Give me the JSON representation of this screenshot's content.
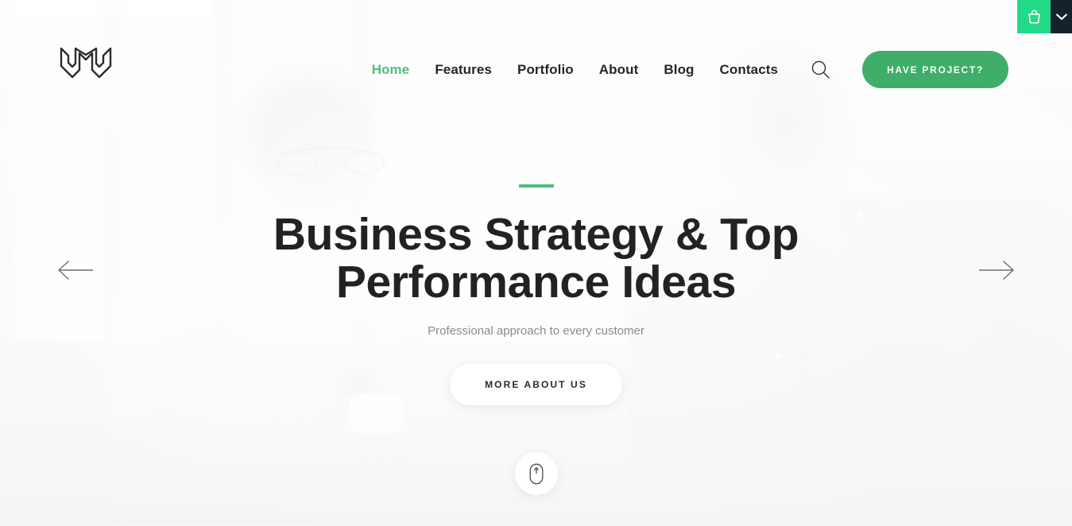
{
  "corner": {
    "cart_icon": "basket-icon",
    "toggle_icon": "chevron-down-icon",
    "cart_color": "#22d98a",
    "toggle_color": "#16212e"
  },
  "header": {
    "logo_name": "brand-logo",
    "nav": [
      {
        "label": "Home",
        "active": true
      },
      {
        "label": "Features",
        "active": false
      },
      {
        "label": "Portfolio",
        "active": false
      },
      {
        "label": "About",
        "active": false
      },
      {
        "label": "Blog",
        "active": false
      },
      {
        "label": "Contacts",
        "active": false
      }
    ],
    "search_icon": "search-icon",
    "cta_label": "HAVE PROJECT?",
    "cta_color": "#3fae68",
    "active_link_color": "#4ec07c"
  },
  "slide": {
    "accent_color": "#4bbf7a",
    "headline_line1": "Business Strategy & Top",
    "headline_line2": "Performance Ideas",
    "subtitle": "Professional approach to every customer",
    "button_label": "MORE ABOUT US",
    "prev_icon": "arrow-left-icon",
    "next_icon": "arrow-right-icon",
    "scroll_icon": "mouse-scroll-icon"
  }
}
